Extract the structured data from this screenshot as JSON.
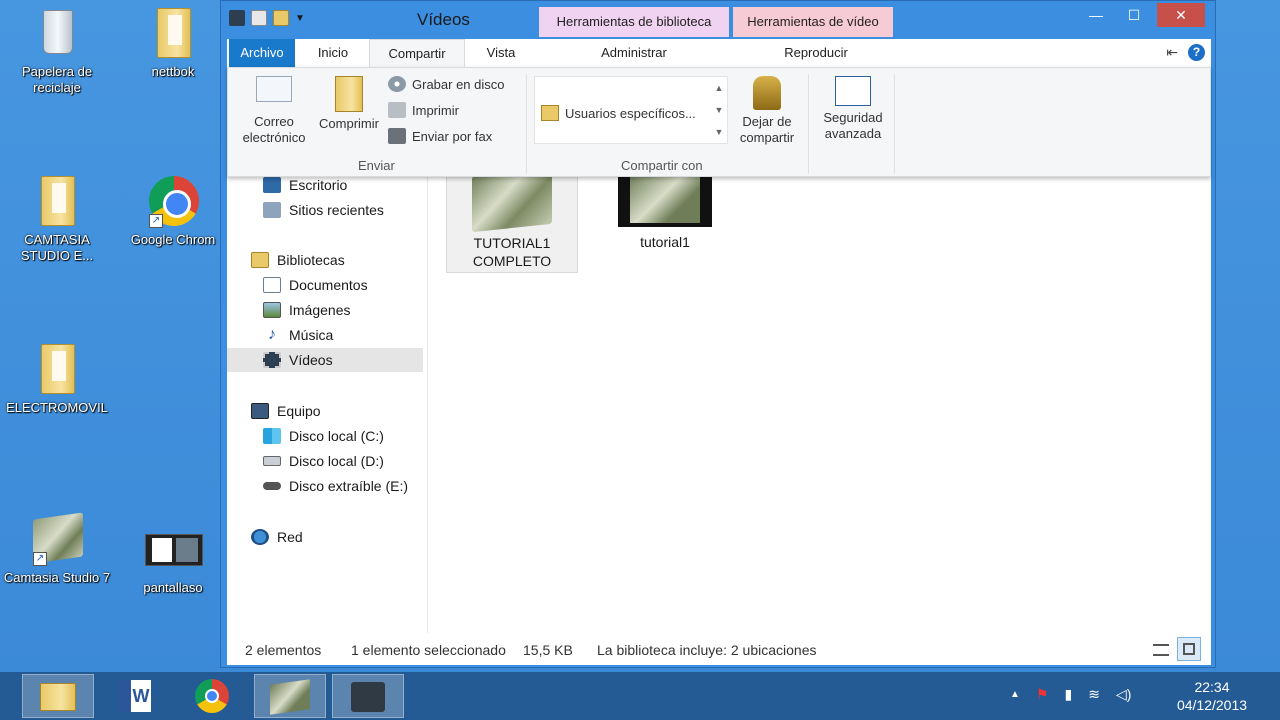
{
  "desktop": {
    "icons": [
      {
        "label": "Papelera de reciclaje",
        "icon": "recycle-bin-icon"
      },
      {
        "label": "nettbok",
        "icon": "folder-icon"
      },
      {
        "label": "CAMTASIA STUDIO E...",
        "icon": "folder-icon"
      },
      {
        "label": "Google Chrom",
        "icon": "chrome-icon"
      },
      {
        "label": "ELECTROMOVIL",
        "icon": "folder-icon"
      },
      {
        "label": "Camtasia Studio 7",
        "icon": "camtasia-icon"
      },
      {
        "label": "pantallaso",
        "icon": "image-icon"
      }
    ]
  },
  "window": {
    "title": "Vídeos",
    "contextual_tabs": {
      "library_tools": "Herramientas de biblioteca",
      "video_tools": "Herramientas de vídeo"
    },
    "controls": {
      "minimize": "—",
      "maximize": "☐",
      "close": "✕"
    }
  },
  "ribbon": {
    "tabs": {
      "archivo": "Archivo",
      "inicio": "Inicio",
      "compartir": "Compartir",
      "vista": "Vista",
      "administrar": "Administrar",
      "reproducir": "Reproducir"
    },
    "enviar": {
      "email": "Correo electrónico",
      "compress": "Comprimir",
      "burn": "Grabar en disco",
      "print": "Imprimir",
      "fax": "Enviar por fax",
      "group_label": "Enviar"
    },
    "compartir_con": {
      "item": "Usuarios específicos...",
      "stop_sharing": "Dejar de compartir",
      "group_label": "Compartir con"
    },
    "security": "Seguridad avanzada"
  },
  "nav": {
    "favorites": [
      {
        "label": "Escritorio",
        "icon": "desktop-icon"
      },
      {
        "label": "Sitios recientes",
        "icon": "recent-places-icon"
      }
    ],
    "libraries_header": "Bibliotecas",
    "libraries": [
      {
        "label": "Documentos",
        "icon": "documents-icon"
      },
      {
        "label": "Imágenes",
        "icon": "pictures-icon"
      },
      {
        "label": "Música",
        "icon": "music-icon"
      },
      {
        "label": "Vídeos",
        "icon": "videos-icon"
      }
    ],
    "computer_header": "Equipo",
    "drives": [
      {
        "label": "Disco local (C:)",
        "icon": "windows-drive-icon"
      },
      {
        "label": "Disco local (D:)",
        "icon": "drive-icon"
      },
      {
        "label": "Disco extraíble (E:)",
        "icon": "removable-drive-icon"
      }
    ],
    "network": "Red"
  },
  "files": [
    {
      "label_line1": "TUTORIAL1",
      "label_line2": "COMPLETO",
      "icon": "camtasia-project-icon"
    },
    {
      "label_line1": "tutorial1",
      "label_line2": "",
      "icon": "video-file-icon"
    }
  ],
  "status": {
    "count": "2 elementos",
    "selected": "1 elemento seleccionado",
    "size": "15,5 KB",
    "library": "La biblioteca incluye: 2 ubicaciones"
  },
  "taskbar": {
    "time": "22:34",
    "date": "04/12/2013"
  },
  "colors": {
    "desktop": "#3b8ad8",
    "archivo_tab": "#1979ca",
    "library_tools": "#f0d3f1",
    "video_tools": "#f7cbd6",
    "close_button": "#c7514a",
    "taskbar": "#245b94"
  }
}
